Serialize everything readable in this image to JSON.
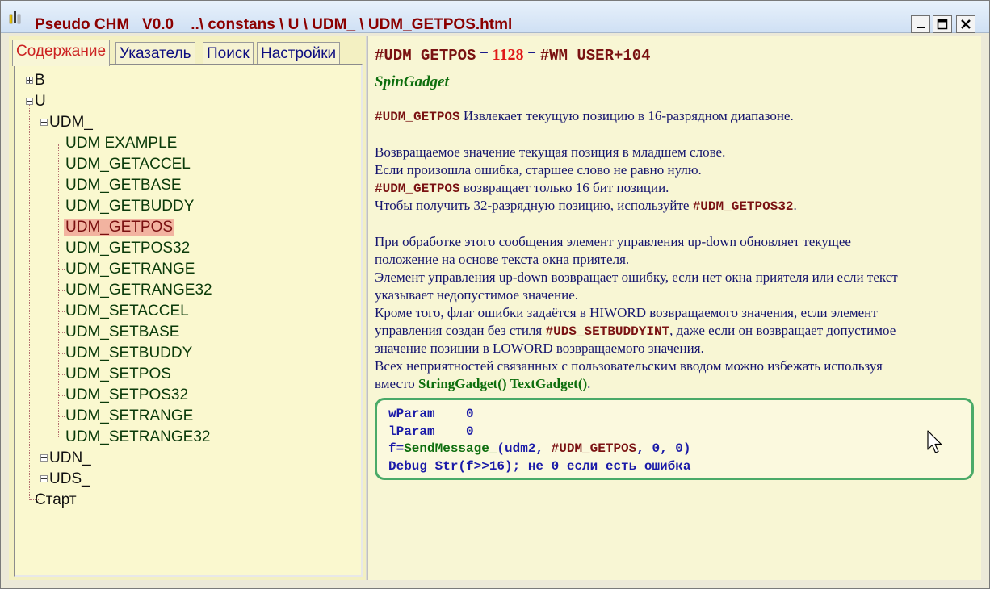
{
  "window": {
    "app_name": "Pseudo CHM",
    "version": "V0.0",
    "path": "..\\ constans \\ U \\ UDM_ \\ UDM_GETPOS.html",
    "buttons": [
      "minimize",
      "maximize",
      "close"
    ]
  },
  "tabs": [
    {
      "label": "Содержание",
      "active": true
    },
    {
      "label": "Указатель",
      "active": false
    },
    {
      "label": "Поиск",
      "active": false
    },
    {
      "label": "Настройки",
      "active": false
    }
  ],
  "tree": {
    "b": "B",
    "u": "U",
    "udm": "UDM_",
    "udm_children": [
      "UDM EXAMPLE",
      "UDM_GETACCEL",
      "UDM_GETBASE",
      "UDM_GETBUDDY",
      "UDM_GETPOS",
      "UDM_GETPOS32",
      "UDM_GETRANGE",
      "UDM_GETRANGE32",
      "UDM_SETACCEL",
      "UDM_SETBASE",
      "UDM_SETBUDDY",
      "UDM_SETPOS",
      "UDM_SETPOS32",
      "UDM_SETRANGE",
      "UDM_SETRANGE32"
    ],
    "selected": "UDM_GETPOS",
    "udn": "UDN_",
    "uds": "UDS_",
    "start": "Старт"
  },
  "content": {
    "heading_const": "#UDM_GETPOS",
    "heading_eq1": " = ",
    "heading_value": "1128",
    "heading_eq2": " = ",
    "heading_expr": "#WM_USER+104",
    "subtitle": "SpinGadget",
    "p1_kw": "#UDM_GETPOS",
    "p1_text": " Извлекает текущую позицию в 16-разрядном диапазоне.",
    "p2_l1": "Возвращаемое значение текущая позиция в младшем слове.",
    "p2_l2": "Если произошла ошибка, старшее слово не равно нулю.",
    "p2_l3_kw": "#UDM_GETPOS",
    "p2_l3_text": " возвращает только 16 бит позиции.",
    "p2_l4_text": "Чтобы получить 32-разрядную позицию, используйте ",
    "p2_l4_kw": "#UDM_GETPOS32",
    "p2_l4_end": ".",
    "p3_l1": "При обработке этого сообщения элемент управления up-down обновляет текущее",
    "p3_l2": "положение на основе текста окна приятеля.",
    "p3_l3": "Элемент управления up-down возвращает ошибку, если нет окна приятеля или если текст",
    "p3_l4": "указывает недопустимое значение.",
    "p3_l5": "Кроме того, флаг ошибки задаётся в HIWORD возвращаемого значения, если элемент",
    "p3_l6_text": "управления создан без стиля ",
    "p3_l6_kw": "#UDS_SETBUDDYINT",
    "p3_l6_end": ", даже если он возвращает допустимое",
    "p3_l7": "значение позиции в LOWORD возвращаемого значения.",
    "p3_l8": "Всех неприятностей связанных с пользовательским вводом можно избежать используя",
    "p3_l9_text": "вместо ",
    "p3_l9_fn": "StringGadget() TextGadget()",
    "p3_l9_end": "."
  },
  "code": {
    "l1": "wParam    0",
    "l2": "lParam    0",
    "l3_a": "f=",
    "l3_fn": "SendMessage_",
    "l3_b": "(udm2, ",
    "l3_kw": "#UDM_GETPOS",
    "l3_c": ", 0, 0)",
    "l4": "Debug Str(f>>16); не 0 если есть ошибка"
  },
  "colors": {
    "title": "#8b0000",
    "keyword": "#7a1212",
    "function": "#0e6e0e",
    "text": "#15156e",
    "selection": "#f2b3a0",
    "codebox_border": "#4aaa68"
  }
}
